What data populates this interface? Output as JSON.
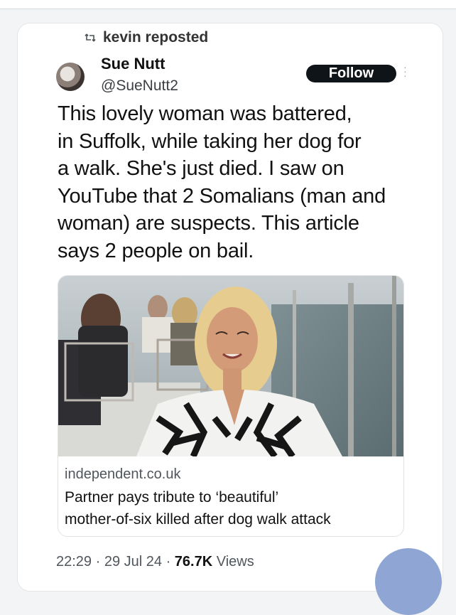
{
  "repost": {
    "text": "kevin reposted",
    "icon": "repost-icon"
  },
  "author": {
    "name": "Sue Nutt",
    "handle": "@SueNutt2",
    "follow_label": "Follow"
  },
  "tweet": {
    "lines": [
      "This lovely woman was battered,",
      "in Suffolk, while taking her dog for",
      "a walk. She's just died. I saw on",
      "YouTube that 2 Somalians (man and",
      "woman) are suspects. This article",
      "says 2 people on bail."
    ]
  },
  "link_card": {
    "domain": "independent.co.uk",
    "headline_lines": [
      "Partner pays tribute to ‘beautiful’",
      "mother-of-six killed after dog walk attack"
    ]
  },
  "meta": {
    "time": "22:29",
    "sep1": " · ",
    "date": "29 Jul 24",
    "sep2": " · ",
    "views_count": "76.7K",
    "views_label": " Views"
  },
  "colors": {
    "follow_bg": "#0f1419",
    "muted_text": "#50565c",
    "fab": "#8fa5d3"
  }
}
